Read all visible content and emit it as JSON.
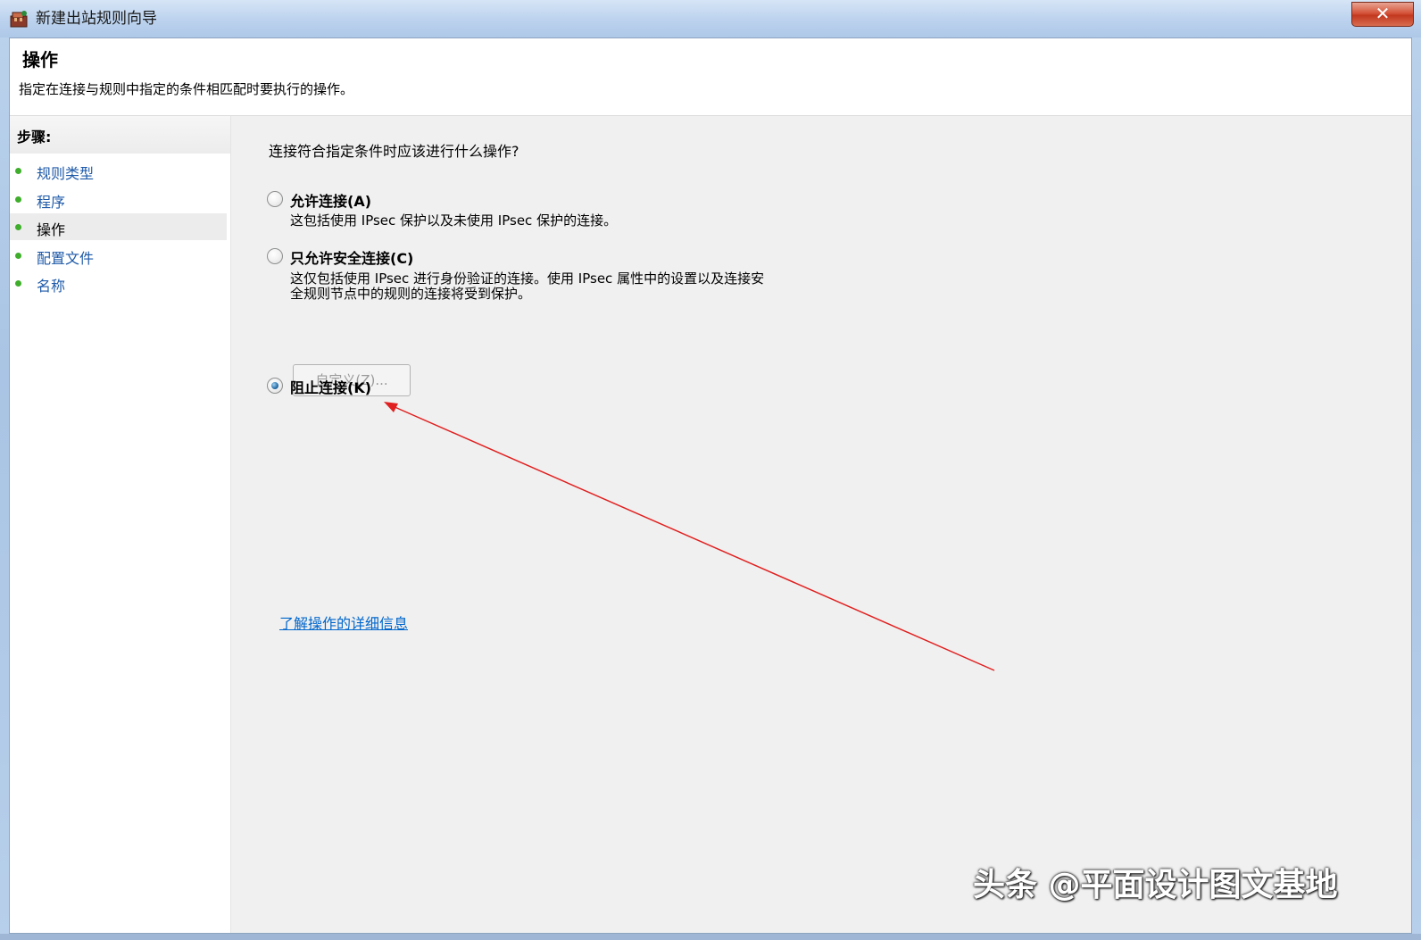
{
  "window": {
    "title": "新建出站规则向导",
    "close_glyph": "✕"
  },
  "header": {
    "title": "操作",
    "description": "指定在连接与规则中指定的条件相匹配时要执行的操作。"
  },
  "steps": {
    "title": "步骤:",
    "items": [
      {
        "label": "规则类型"
      },
      {
        "label": "程序"
      },
      {
        "label": "操作"
      },
      {
        "label": "配置文件"
      },
      {
        "label": "名称"
      }
    ],
    "current_index": 2
  },
  "main": {
    "question": "连接符合指定条件时应该进行什么操作?",
    "options": [
      {
        "label": "允许连接(A)",
        "description": "这包括使用 IPsec 保护以及未使用 IPsec 保护的连接。",
        "checked": false
      },
      {
        "label": "只允许安全连接(C)",
        "description_line1": "这仅包括使用 IPsec 进行身份验证的连接。使用 IPsec 属性中的设置以及连接安",
        "description_line2": "全规则节点中的规则的连接将受到保护。",
        "checked": false
      },
      {
        "label": "阻止连接(K)",
        "checked": true
      }
    ],
    "custom_button": "自定义(Z)...",
    "learn_link": "了解操作的详细信息"
  },
  "watermark": "头条 @平面设计图文基地",
  "colors": {
    "annotation_arrow": "#e02020",
    "link": "#0066cc",
    "step_dot": "#3fae2c"
  }
}
